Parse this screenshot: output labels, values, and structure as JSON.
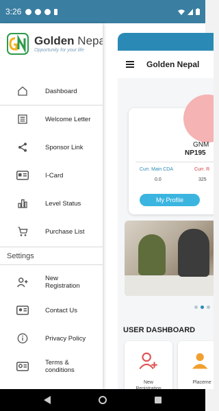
{
  "status_bar": {
    "time": "3:26"
  },
  "drawer": {
    "brand_name": "Golden",
    "brand_name2": "Nepal",
    "tagline": "Opportunity for your life",
    "items": [
      {
        "label": "Dashboard",
        "icon": "home-icon"
      },
      {
        "label": "Welcome Letter",
        "icon": "list-icon"
      },
      {
        "label": "Sponsor Link",
        "icon": "share-icon"
      },
      {
        "label": "I-Card",
        "icon": "id-card-icon"
      },
      {
        "label": "Level Status",
        "icon": "bar-chart-icon"
      },
      {
        "label": "Purchase List",
        "icon": "cart-icon"
      }
    ],
    "settings_heading": "Settings",
    "settings_items": [
      {
        "label": "New\nRegistration",
        "icon": "add-person-icon"
      },
      {
        "label": "Contact Us",
        "icon": "contact-card-icon"
      },
      {
        "label": "Privacy Policy",
        "icon": "info-icon"
      },
      {
        "label": "Terms &\nconditions",
        "icon": "terms-card-icon"
      }
    ]
  },
  "background_app": {
    "app_title": "Golden Nepal",
    "profile": {
      "name_partial": "GNM",
      "id_partial": "NP195",
      "curr_main_label": "Curr. Main CDA",
      "curr_main_value": "0.0",
      "curr_r_label": "Curr. R",
      "curr_r_value": "325",
      "button_label": "My Profile"
    },
    "dashboard_title": "USER DASHBOARD",
    "tiles": [
      {
        "label": "New\nRegistration"
      },
      {
        "label": "Placeme"
      }
    ]
  },
  "colors": {
    "status_bar": "#3a7ea2",
    "accent": "#2b8ab5",
    "button": "#3bb5e0"
  }
}
